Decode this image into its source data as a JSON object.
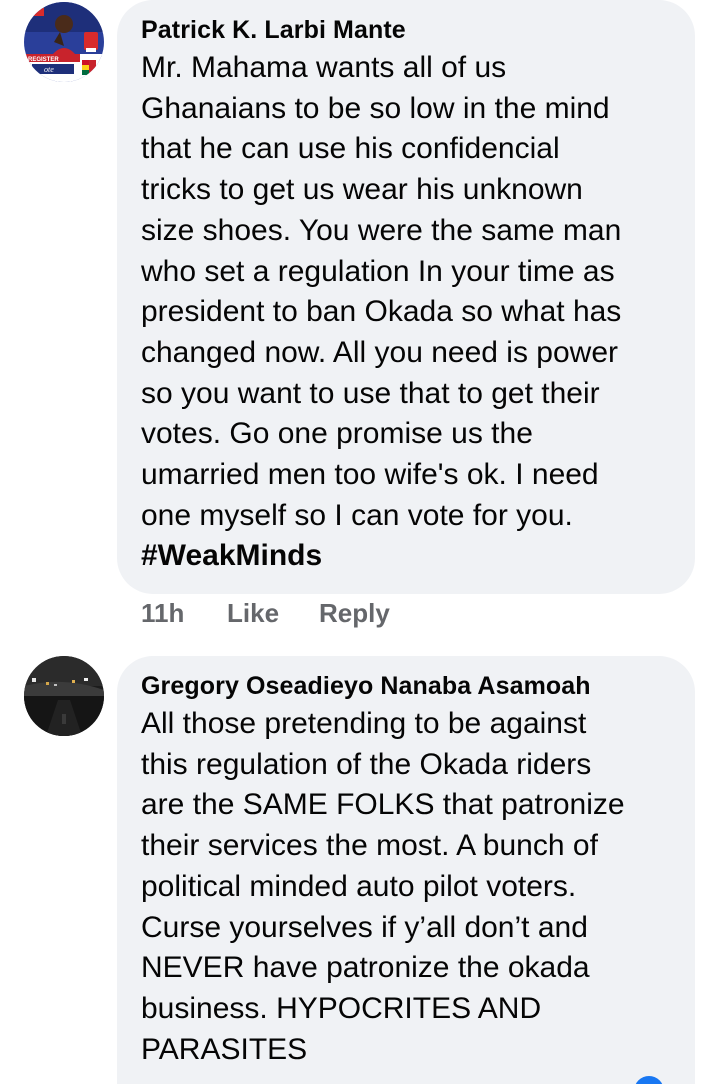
{
  "comments": [
    {
      "author": "Patrick K. Larbi Mante",
      "avatar_icon": "profile-photo-avatar",
      "text_lines": [
        "Mr. Mahama wants all of us",
        "Ghanaians to be so low in the mind",
        "that he can use his confidencial",
        "tricks to get us wear his unknown",
        "size shoes. You were the same man",
        "who set a regulation In your time as",
        "president to ban Okada so what has",
        "changed now. All you need is power",
        "so you want to use that to get their",
        "votes. Go one promise us the",
        "umarried men too wife's ok. I need",
        "one myself so I can vote for you."
      ],
      "hashtag": "#WeakMinds",
      "avatar_badge_text_1": "REGISTER",
      "avatar_badge_text_2": "ote",
      "time": "11h",
      "like_label": "Like",
      "reply_label": "Reply"
    },
    {
      "author": "Gregory Oseadieyo Nanaba Asamoah",
      "avatar_icon": "night-road-photo-avatar",
      "text_lines": [
        "All those pretending to be against",
        "this regulation of the Okada riders",
        "are the SAME FOLKS that patronize",
        "their services the most. A bunch of",
        "political minded auto pilot voters.",
        "Curse yourselves if y’all don’t and",
        "NEVER have patronize the okada",
        "business. HYPOCRITES AND",
        "PARASITES"
      ]
    }
  ],
  "colors": {
    "bubble_bg": "#f0f2f5",
    "text": "#050505",
    "secondary_text": "#65676b",
    "accent": "#1877f2"
  }
}
